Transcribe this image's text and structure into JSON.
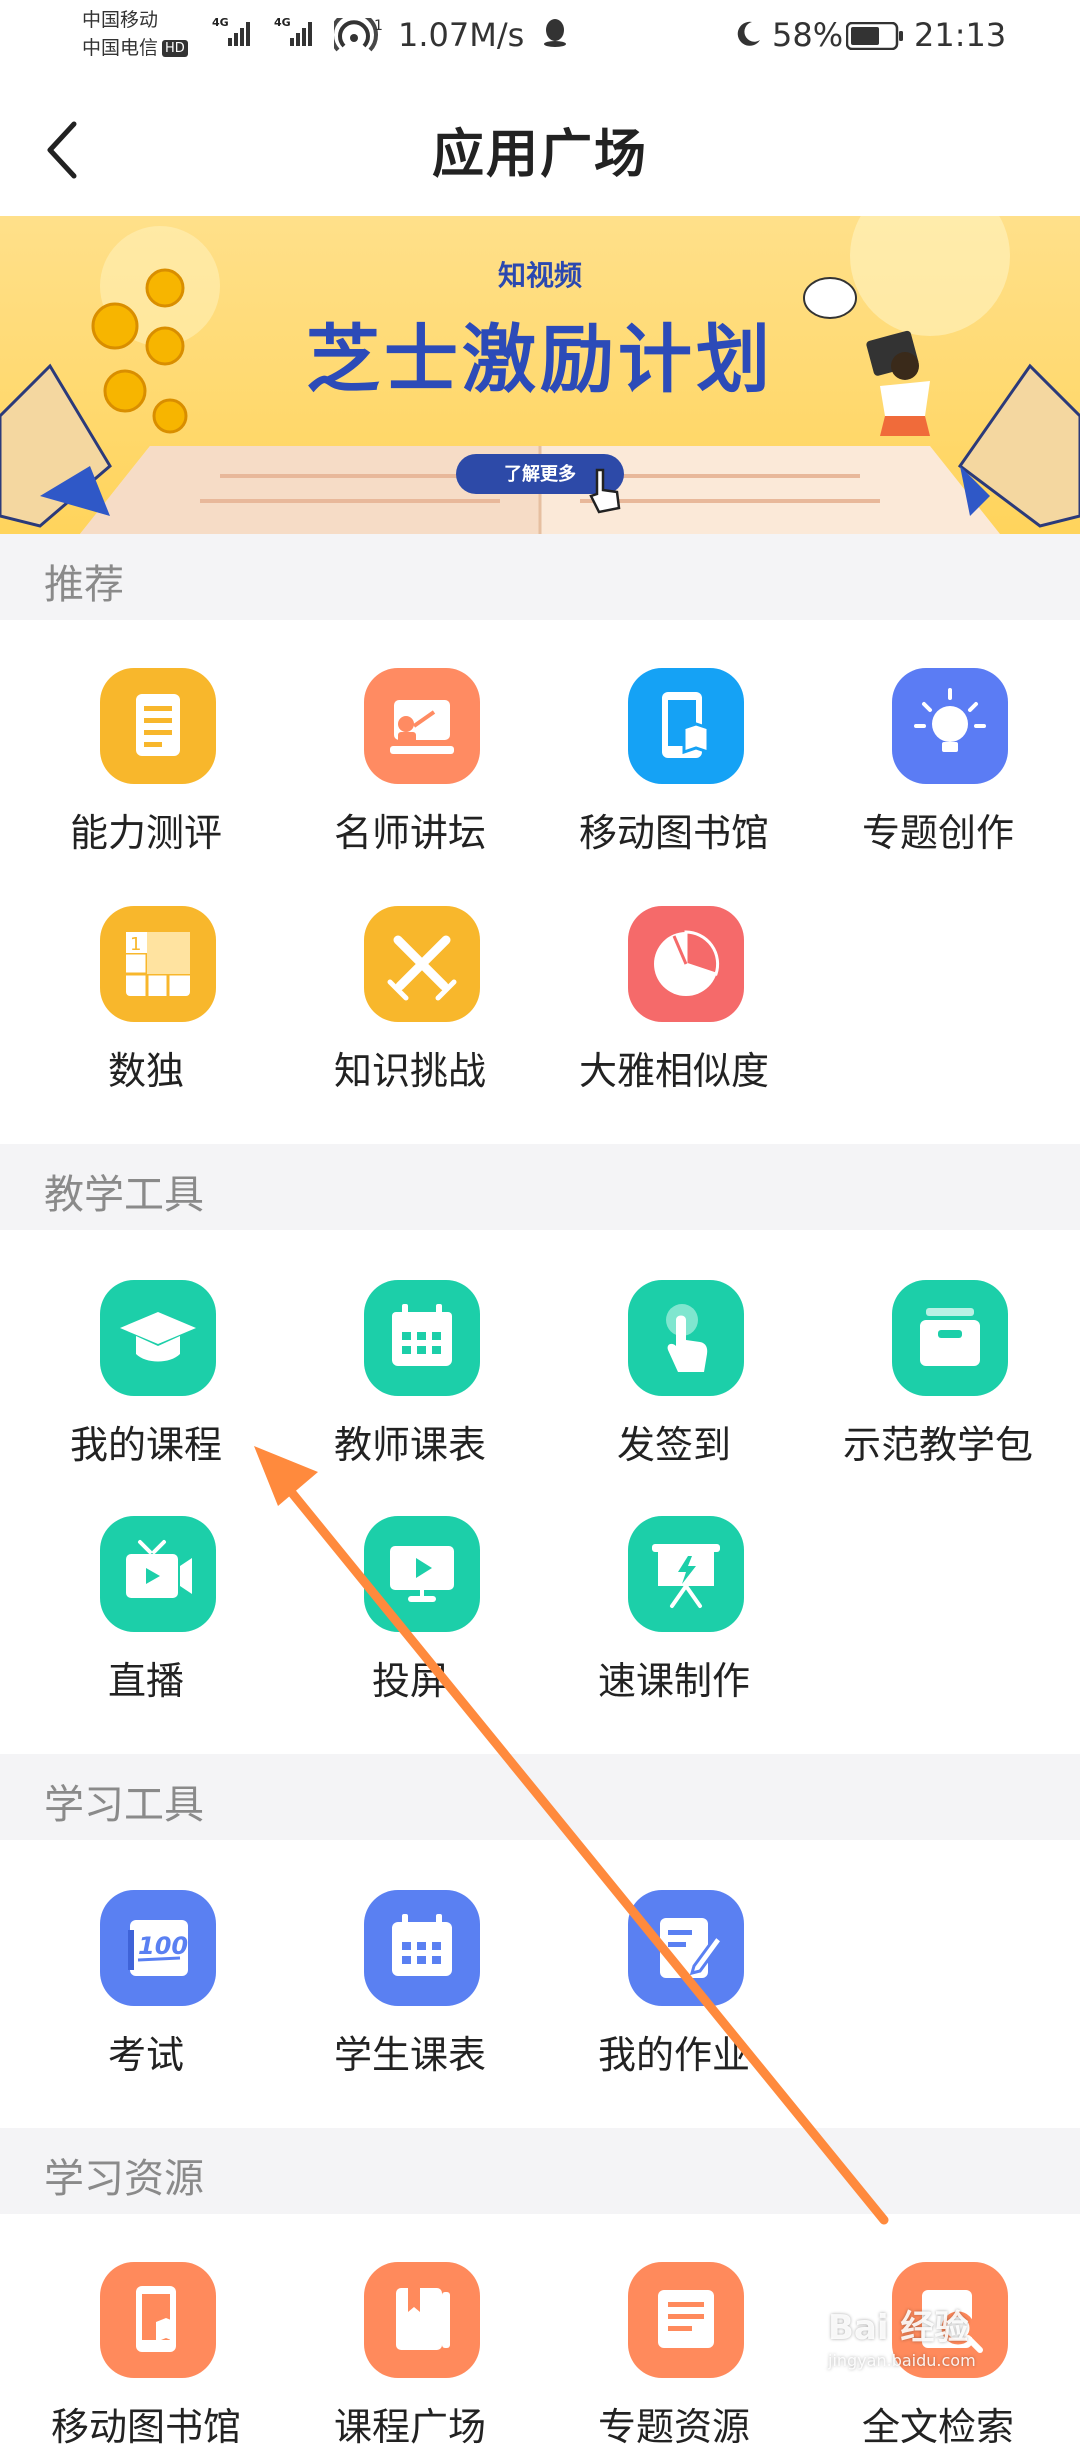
{
  "status_bar": {
    "carrier_1": "中国移动",
    "carrier_2": "中国电信",
    "hd": "HD",
    "net_1": "4G",
    "net_2": "4G",
    "wifi_sup": "1",
    "speed": "1.07M/s",
    "battery": "58%",
    "time": "21:13"
  },
  "header": {
    "title": "应用广场"
  },
  "banner": {
    "subtitle": "知视频",
    "title": "芝士激励计划",
    "button": "了解更多"
  },
  "sections": [
    {
      "title": "推荐",
      "items": [
        {
          "label": "能力测评",
          "icon": "clipboard-icon",
          "color": "#f8b72c"
        },
        {
          "label": "名师讲坛",
          "icon": "lecturer-icon",
          "color": "#ff8b62"
        },
        {
          "label": "移动图书馆",
          "icon": "mobile-library-icon",
          "color": "#15a2f5"
        },
        {
          "label": "专题创作",
          "icon": "lightbulb-icon",
          "color": "#5b7cf4"
        },
        {
          "label": "数独",
          "icon": "sudoku-icon",
          "color": "#f8b72c"
        },
        {
          "label": "知识挑战",
          "icon": "crossed-swords-icon",
          "color": "#f8b72c"
        },
        {
          "label": "大雅相似度",
          "icon": "pie-chart-icon",
          "color": "#f56a6a"
        }
      ]
    },
    {
      "title": "教学工具",
      "items": [
        {
          "label": "我的课程",
          "icon": "graduation-cap-icon",
          "color": "#1ccfa9"
        },
        {
          "label": "教师课表",
          "icon": "calendar-icon",
          "color": "#1ccfa9"
        },
        {
          "label": "发签到",
          "icon": "tap-hand-icon",
          "color": "#1ccfa9"
        },
        {
          "label": "示范教学包",
          "icon": "package-icon",
          "color": "#1ccfa9"
        },
        {
          "label": "直播",
          "icon": "tv-icon",
          "color": "#1ccfa9"
        },
        {
          "label": "投屏",
          "icon": "screen-cast-icon",
          "color": "#1ccfa9"
        },
        {
          "label": "速课制作",
          "icon": "presentation-icon",
          "color": "#1ccfa9"
        }
      ]
    },
    {
      "title": "学习工具",
      "items": [
        {
          "label": "考试",
          "icon": "exam-score-icon",
          "color": "#5a80f2"
        },
        {
          "label": "学生课表",
          "icon": "calendar-icon",
          "color": "#5a80f2"
        },
        {
          "label": "我的作业",
          "icon": "homework-edit-icon",
          "color": "#5a80f2"
        }
      ]
    },
    {
      "title": "学习资源",
      "items": [
        {
          "label": "移动图书馆",
          "icon": "mobile-book-icon",
          "color": "#ff8a5c"
        },
        {
          "label": "课程广场",
          "icon": "book-icon",
          "color": "#ff8a5c"
        },
        {
          "label": "专题资源",
          "icon": "document-icon",
          "color": "#ff8a5c"
        },
        {
          "label": "全文检索",
          "icon": "search-doc-icon",
          "color": "#ff8a5c"
        }
      ]
    }
  ],
  "watermark": {
    "text": "Bai 经验",
    "sub": "jingyan.baidu.com"
  }
}
